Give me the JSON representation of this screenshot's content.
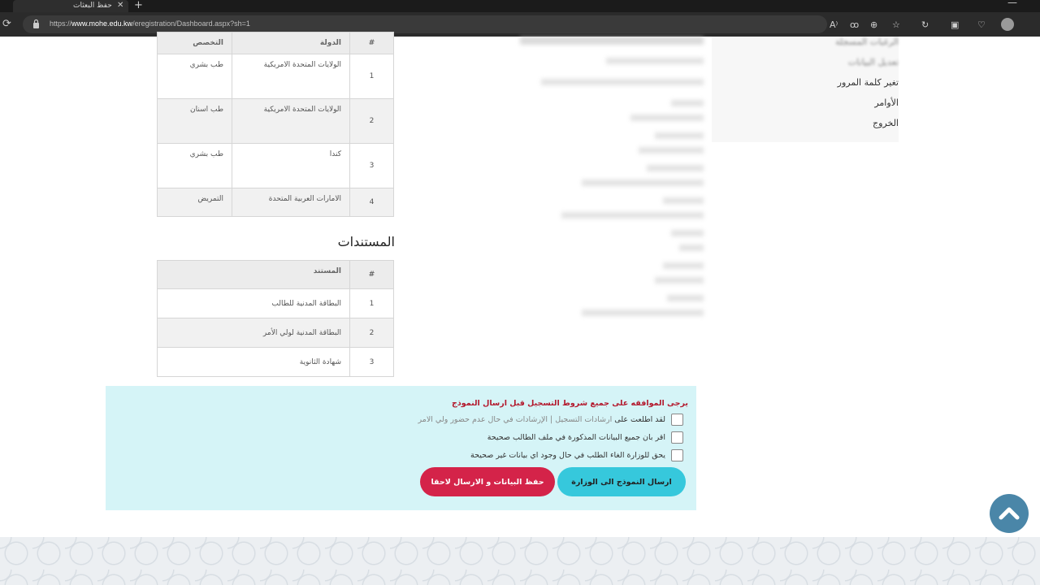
{
  "browser": {
    "tab_title": "حفظ البعثات",
    "tab_close": "✕",
    "new_tab": "+",
    "url_prefix": "https://",
    "url_domain": "www.mohe.edu.kw",
    "url_path": "/eregistration/Dashboard.aspx?sh=1",
    "reload_glyph": "⟳",
    "toolbar_icons": [
      "A⁾",
      "ꝏ",
      "⊕",
      "☆",
      "↻",
      "▣",
      "♡"
    ]
  },
  "sidebar": {
    "items": [
      {
        "label": "الرغبات المسجلة",
        "blurred": true
      },
      {
        "label": "تعديل البيانات",
        "blurred": true
      },
      {
        "label": "تغير كلمة المرور",
        "blurred": false
      },
      {
        "label": "الأوامر",
        "blurred": false
      },
      {
        "label": "الخروج",
        "blurred": false
      }
    ]
  },
  "wishes_table": {
    "headers": [
      "#",
      "الدولة",
      "التخصص"
    ],
    "rows": [
      {
        "num": "1",
        "country": "الولايات المتحدة الامريكية",
        "major": "طب بشري"
      },
      {
        "num": "2",
        "country": "الولايات المتحدة الامريكية",
        "major": "طب اسنان"
      },
      {
        "num": "3",
        "country": "كندا",
        "major": "طب بشري"
      },
      {
        "num": "4",
        "country": "الامارات العربية المتحدة",
        "major": "التمريض"
      }
    ]
  },
  "documents": {
    "title": "المستندات",
    "headers": [
      "#",
      "المستند"
    ],
    "rows": [
      {
        "num": "1",
        "name": "البطاقة المدنية للطالب"
      },
      {
        "num": "2",
        "name": "البطاقة المدنية لولي الأمر"
      },
      {
        "num": "3",
        "name": "شهادة الثانوية"
      }
    ]
  },
  "consent": {
    "heading": "يرجى الموافقه على جميع شروط التسجيل قبل ارسال النموذج",
    "items": [
      {
        "text": "لقد اطلعت على",
        "link": "ارشادات التسجيل",
        "rest": "| الإرشادات في حال عدم حضور ولي الامر",
        "checked": false
      },
      {
        "text": "اقر بان جميع البيانات المذكورة في ملف الطالب صحيحة",
        "checked": false
      },
      {
        "text": "يحق للوزارة الغاء الطلب في حال وجود اي بيانات غير صحيحة",
        "checked": false
      }
    ],
    "send_button": "ارسال النموذج الى الوزارة",
    "save_button": "حفظ البيانات و الارسال لاحقا"
  },
  "scroll_top_icon": "chevron-up-icon"
}
